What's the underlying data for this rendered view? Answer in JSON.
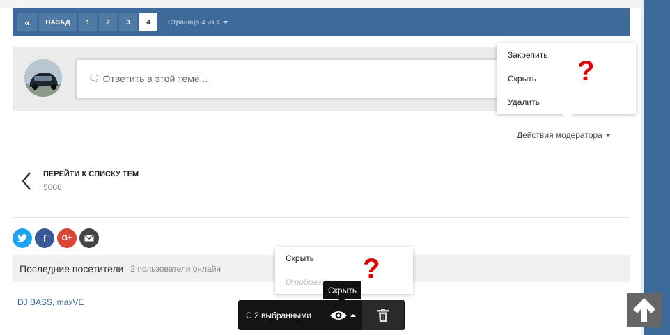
{
  "pagination": {
    "first_icon": "«",
    "prev_label": "НАЗАД",
    "pages": [
      "1",
      "2",
      "3",
      "4"
    ],
    "active_page": "4",
    "page_info": "Страница 4 из 4"
  },
  "reply": {
    "placeholder": "Ответить в этой теме..."
  },
  "moderator_menu": {
    "items": [
      "Закрепить",
      "Скрыть",
      "Удалить"
    ],
    "question_mark": "?"
  },
  "moderator_actions": {
    "label": "Действия модератора"
  },
  "back_link": {
    "title": "ПЕРЕЙТИ К СПИСКУ ТЕМ",
    "subtitle": "5008"
  },
  "social": {
    "icons": [
      "twitter-icon",
      "facebook-icon",
      "google-plus-icon",
      "email-icon"
    ],
    "glyphs": [
      "t",
      "f",
      "G+",
      "✉"
    ]
  },
  "visitors": {
    "title": "Последние посетители",
    "count": "2 пользователя онлайн",
    "names": "DJ BASS, maxVE"
  },
  "selection_bar": {
    "label": "С 2 выбранными",
    "tooltip": "Скрыть"
  },
  "hide_menu": {
    "items": [
      "Скрыть",
      "Отобразить"
    ],
    "question_mark": "?"
  },
  "colors": {
    "primary": "#3d6a99",
    "question": "#e00000"
  }
}
